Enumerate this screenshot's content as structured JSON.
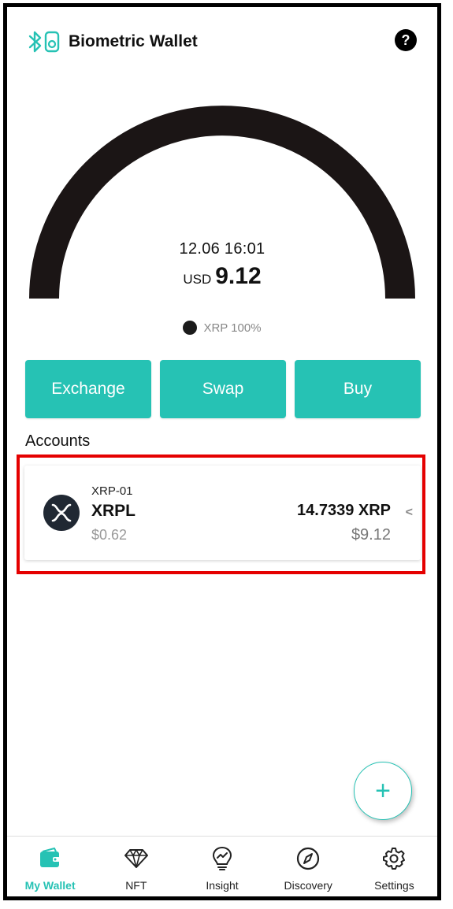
{
  "header": {
    "title": "Biometric Wallet",
    "help_label": "?"
  },
  "summary": {
    "timestamp": "12.06 16:01",
    "currency": "USD",
    "total": "9.12",
    "legend": "XRP 100%",
    "gauge_share_xrp_percent": 100
  },
  "actions": [
    {
      "label": "Exchange"
    },
    {
      "label": "Swap"
    },
    {
      "label": "Buy"
    }
  ],
  "accounts_title": "Accounts",
  "accounts": [
    {
      "id": "XRP-01",
      "name": "XRPL",
      "price": "$0.62",
      "amount": "14.7339 XRP",
      "value": "$9.12",
      "chevron": "<"
    }
  ],
  "fab": {
    "label": "+"
  },
  "nav": [
    {
      "label": "My Wallet",
      "icon": "wallet-icon",
      "active": true
    },
    {
      "label": "NFT",
      "icon": "diamond-icon",
      "active": false
    },
    {
      "label": "Insight",
      "icon": "lightbulb-icon",
      "active": false
    },
    {
      "label": "Discovery",
      "icon": "compass-icon",
      "active": false
    },
    {
      "label": "Settings",
      "icon": "gear-icon",
      "active": false
    }
  ],
  "colors": {
    "accent": "#26c2b4",
    "gauge": "#1b1515",
    "highlight": "#e50000"
  }
}
